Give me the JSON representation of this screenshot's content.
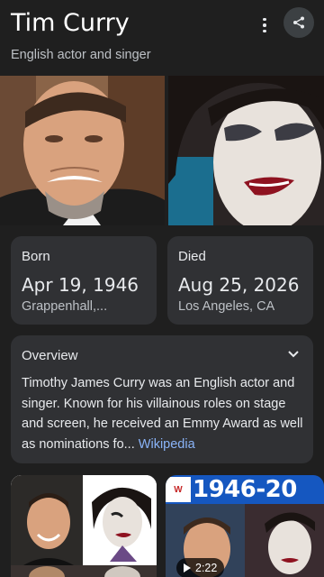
{
  "header": {
    "title": "Tim Curry",
    "subtitle": "English actor and singer"
  },
  "facts": {
    "born": {
      "label": "Born",
      "value": "Apr 19, 1946",
      "place": "Grappenhall,..."
    },
    "died": {
      "label": "Died",
      "value": "Aug 25, 2026",
      "place": "Los Angeles, CA"
    }
  },
  "overview": {
    "title": "Overview",
    "text": "Timothy James Curry was an English actor and singer. Known for his villainous roles on stage and screen, he received an Emmy Award as well as nominations fo",
    "ellipsis": "... ",
    "source": "Wikipedia"
  },
  "media": {
    "video_banner": "1946-20",
    "video_logo": "W",
    "video_duration": "2:22"
  },
  "icons": {
    "more": "more-vert-icon",
    "share": "share-icon",
    "expand": "chevron-down-icon",
    "play": "play-icon"
  },
  "colors": {
    "background": "#1f1f1f",
    "card": "#303134",
    "link": "#8ab4f8"
  }
}
